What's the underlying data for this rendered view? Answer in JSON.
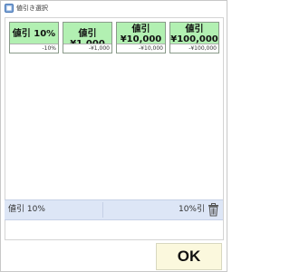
{
  "window": {
    "title": "値引き選択"
  },
  "discount_buttons": [
    {
      "line1": "値引 10%",
      "line2": "",
      "sub": "-10%"
    },
    {
      "line1": "値引¥1,000",
      "line2": "",
      "sub": "-¥1,000"
    },
    {
      "line1": "値引",
      "line2": "¥10,000",
      "sub": "-¥10,000"
    },
    {
      "line1": "値引",
      "line2": "¥100,000",
      "sub": "-¥100,000"
    }
  ],
  "selected_item": {
    "name": "値引 10%",
    "amount": "10%引"
  },
  "ok_label": "OK",
  "colors": {
    "button_bg": "#b2f0b2",
    "selected_row_bg": "#dde6f6",
    "ok_bg": "#fbf8dd"
  }
}
